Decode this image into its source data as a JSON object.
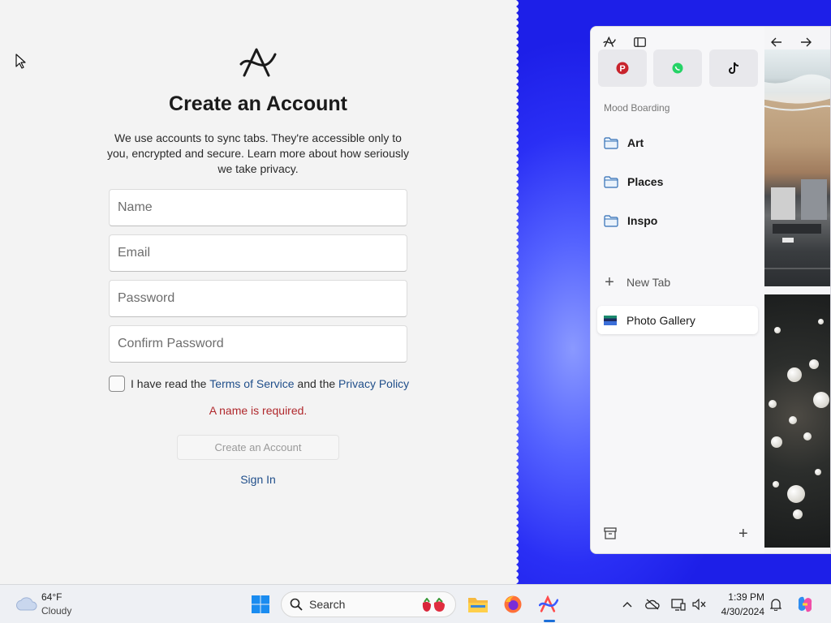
{
  "signup": {
    "title": "Create an Account",
    "subtitle": "We use accounts to sync tabs. They're accessible only to you, encrypted and secure. Learn more about how seriously we take privacy.",
    "name_placeholder": "Name",
    "email_placeholder": "Email",
    "password_placeholder": "Password",
    "confirm_placeholder": "Confirm Password",
    "agree_prefix": "I have read the ",
    "terms_link": "Terms of Service",
    "agree_middle": " and the ",
    "privacy_link": "Privacy Policy",
    "error": "A name is required.",
    "create_button": "Create an Account",
    "signin_link": "Sign In"
  },
  "arc": {
    "favorites": [
      {
        "name": "pinterest-icon"
      },
      {
        "name": "whatsapp-icon"
      },
      {
        "name": "tiktok-icon"
      }
    ],
    "space_title": "Mood Boarding",
    "folders": [
      {
        "label": "Art"
      },
      {
        "label": "Places"
      },
      {
        "label": "Inspo"
      }
    ],
    "new_tab_label": "New Tab",
    "active_tab_label": "Photo Gallery"
  },
  "taskbar": {
    "weather_temp": "64°F",
    "weather_desc": "Cloudy",
    "search_label": "Search",
    "time": "1:39 PM",
    "date": "4/30/2024"
  },
  "colors": {
    "link": "#1f4e8a",
    "error": "#b0282c",
    "desktop_blue": "#2a2ff5",
    "taskbar_active": "#1c6fd8"
  }
}
